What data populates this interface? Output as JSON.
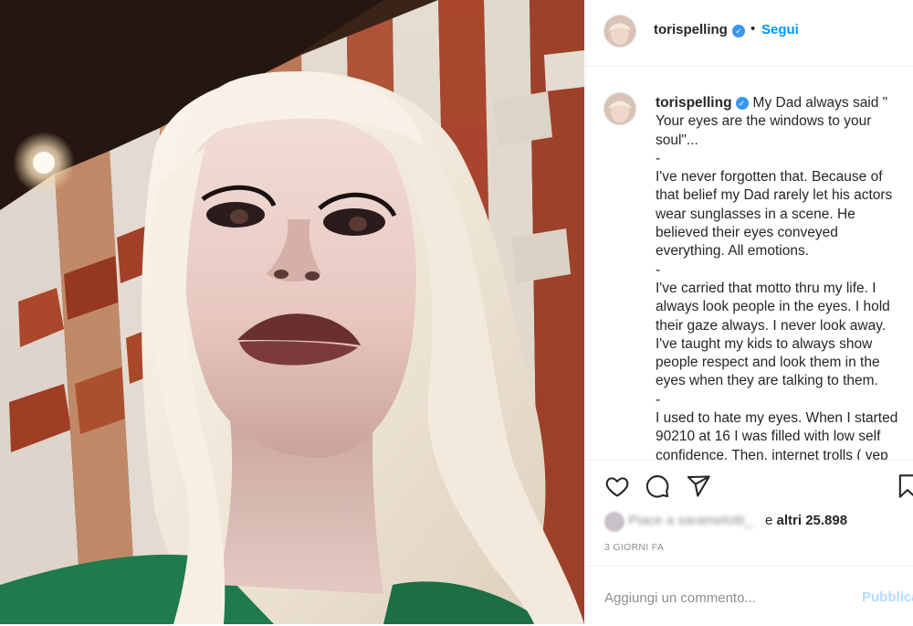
{
  "post": {
    "author": {
      "username": "torispelling",
      "verified_icon": "verified-badge-icon",
      "follow_label": "Segui",
      "follow_separator": "•"
    },
    "caption": {
      "username": "torispelling",
      "text": "My Dad always said \" Your eyes are the windows to your soul\"...\n-\nI've never forgotten that. Because of that belief my Dad rarely let his actors wear sunglasses in a scene. He believed their eyes conveyed everything. All emotions.\n-\nI've carried that motto thru my life. I always look people in the eyes. I hold their gaze always. I never look away. I've taught my kids to always show people respect and look them in the eyes when they are talking to them.\n-\nI used to hate my eyes. When I started 90210 at 16 I was filled with low self confidence. Then, internet trolls (  yep"
    },
    "actions": {
      "icons": [
        "heart-icon",
        "comment-icon",
        "share-icon",
        "bookmark-icon"
      ]
    },
    "likes": {
      "blurred_text": "Piace a saramelotti_",
      "others_prefix": "e",
      "others_text": "altri 25.898"
    },
    "timestamp": "3 GIORNI FA",
    "comment": {
      "placeholder": "Aggiungi un commento...",
      "publish_label": "Pubblica"
    }
  },
  "colors": {
    "accent": "#0095f6",
    "verified": "#3897f0",
    "publish_disabled": "#b3dbff",
    "muted": "#8e8e8e",
    "text": "#262626"
  }
}
